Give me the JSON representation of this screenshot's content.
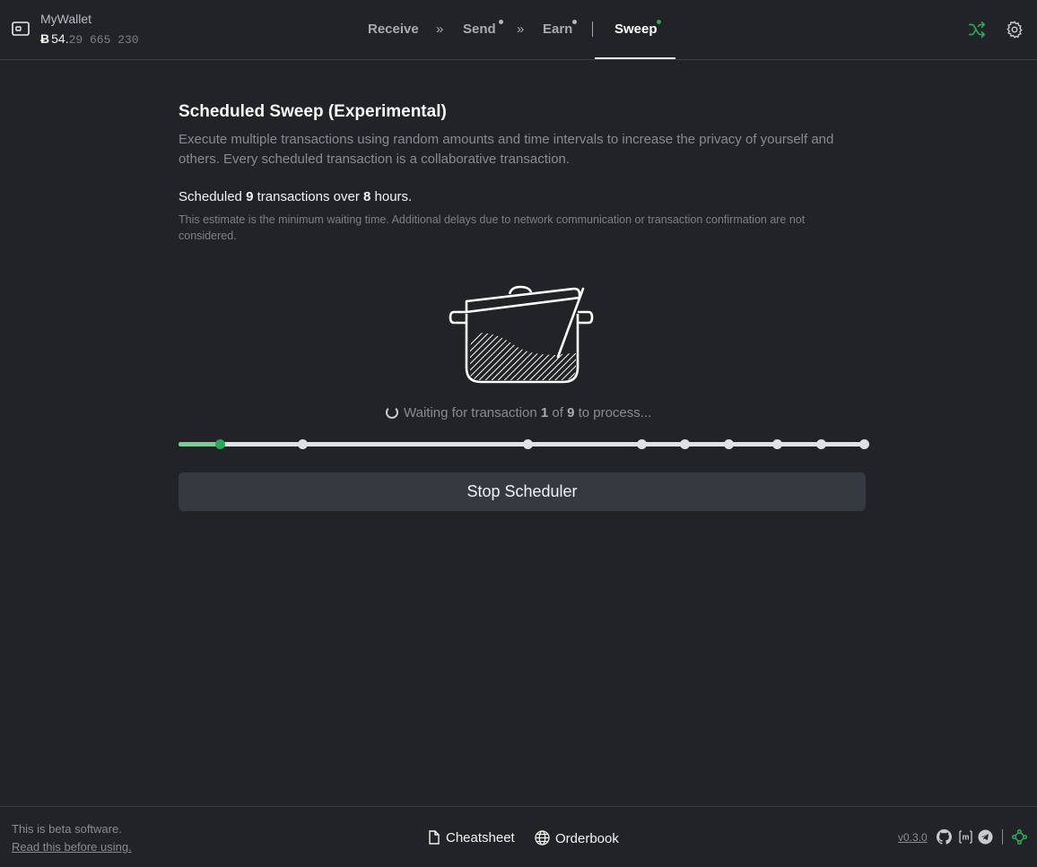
{
  "header": {
    "wallet_name": "MyWallet",
    "balance": {
      "symbol": "Ƀ",
      "integer": "54.",
      "fraction": "29 665 230"
    },
    "nav": {
      "receive": "Receive",
      "send": "Send",
      "earn": "Earn",
      "sweep": "Sweep",
      "separator": "»"
    },
    "icons": [
      "wallet-icon",
      "shuffle-icon",
      "settings-gear-icon"
    ]
  },
  "main": {
    "title": "Scheduled Sweep (Experimental)",
    "description": "Execute multiple transactions using random amounts and time intervals to increase the privacy of yourself and others. Every scheduled transaction is a collaborative transaction.",
    "summary": {
      "prefix": "Scheduled",
      "tx_count": "9",
      "middle": "transactions over",
      "hours": "8",
      "suffix": "hours."
    },
    "note": "This estimate is the minimum waiting time. Additional delays due to network communication or transaction confirmation are not considered.",
    "status": {
      "prefix": "Waiting for transaction",
      "current": "1",
      "of": "of",
      "total": "9",
      "suffix": "to process..."
    },
    "progress": {
      "steps": 9,
      "current_step": 1
    },
    "stop_button": "Stop Scheduler"
  },
  "footer": {
    "beta_text": "This is beta software.",
    "beta_link": "Read this before using.",
    "cheatsheet": "Cheatsheet",
    "orderbook": "Orderbook",
    "version": "v0.3.0",
    "icons": [
      "github-icon",
      "matrix-icon",
      "telegram-icon",
      "network-icon"
    ]
  },
  "colors": {
    "background": "#212326",
    "accent_green": "#2ea35a",
    "track": "#dee2e6"
  }
}
